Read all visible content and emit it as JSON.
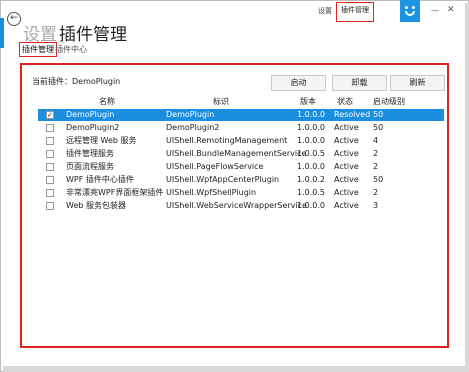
{
  "header": {
    "back_icon": "arrow-left-icon",
    "parent_title": "设置",
    "current_title": "插件管理",
    "subnav": {
      "active": "插件管理",
      "other": "插件中心"
    }
  },
  "topbar": {
    "settings": "设置",
    "plugin_mgmt": "插件管理",
    "logo_icon": "smiley-face-icon",
    "minimize": "—",
    "close": "✕"
  },
  "panel": {
    "current_plugin_label": "当前插件：DemoPlugin",
    "buttons": {
      "start": "启动",
      "unload": "卸载",
      "refresh": "刷新"
    },
    "columns": [
      "名称",
      "标识",
      "版本",
      "状态",
      "启动级别"
    ],
    "rows": [
      {
        "checked": true,
        "name": "DemoPlugin",
        "id": "DemoPlugin",
        "version": "1.0.0.0",
        "status": "Resolved",
        "level": "50"
      },
      {
        "checked": false,
        "name": "DemoPlugin2",
        "id": "DemoPlugin2",
        "version": "1.0.0.0",
        "status": "Active",
        "level": "50"
      },
      {
        "checked": false,
        "name": "远程管理 Web 服务",
        "id": "UIShell.RemotingManagement",
        "version": "1.0.0.0",
        "status": "Active",
        "level": "4"
      },
      {
        "checked": false,
        "name": "插件管理服务",
        "id": "UIShell.BundleManagementService",
        "version": "1.0.0.5",
        "status": "Active",
        "level": "2"
      },
      {
        "checked": false,
        "name": "页面流程服务",
        "id": "UIShell.PageFlowService",
        "version": "1.0.0.0",
        "status": "Active",
        "level": "2"
      },
      {
        "checked": false,
        "name": "WPF  插件中心插件",
        "id": "UIShell.WpfAppCenterPlugin",
        "version": "1.0.0.2",
        "status": "Active",
        "level": "50"
      },
      {
        "checked": false,
        "name": "非常漂亮WPF界面框架插件",
        "id": "UIShell.WpfShellPlugin",
        "version": "1.0.0.5",
        "status": "Active",
        "level": "2"
      },
      {
        "checked": false,
        "name": "Web 服务包装器",
        "id": "UIShell.WebServiceWrapperService",
        "version": "1.0.0.0",
        "status": "Active",
        "level": "3"
      }
    ],
    "selected_row": 0
  },
  "colors": {
    "accent": "#1b8ee0",
    "highlight_border": "#e02424"
  }
}
